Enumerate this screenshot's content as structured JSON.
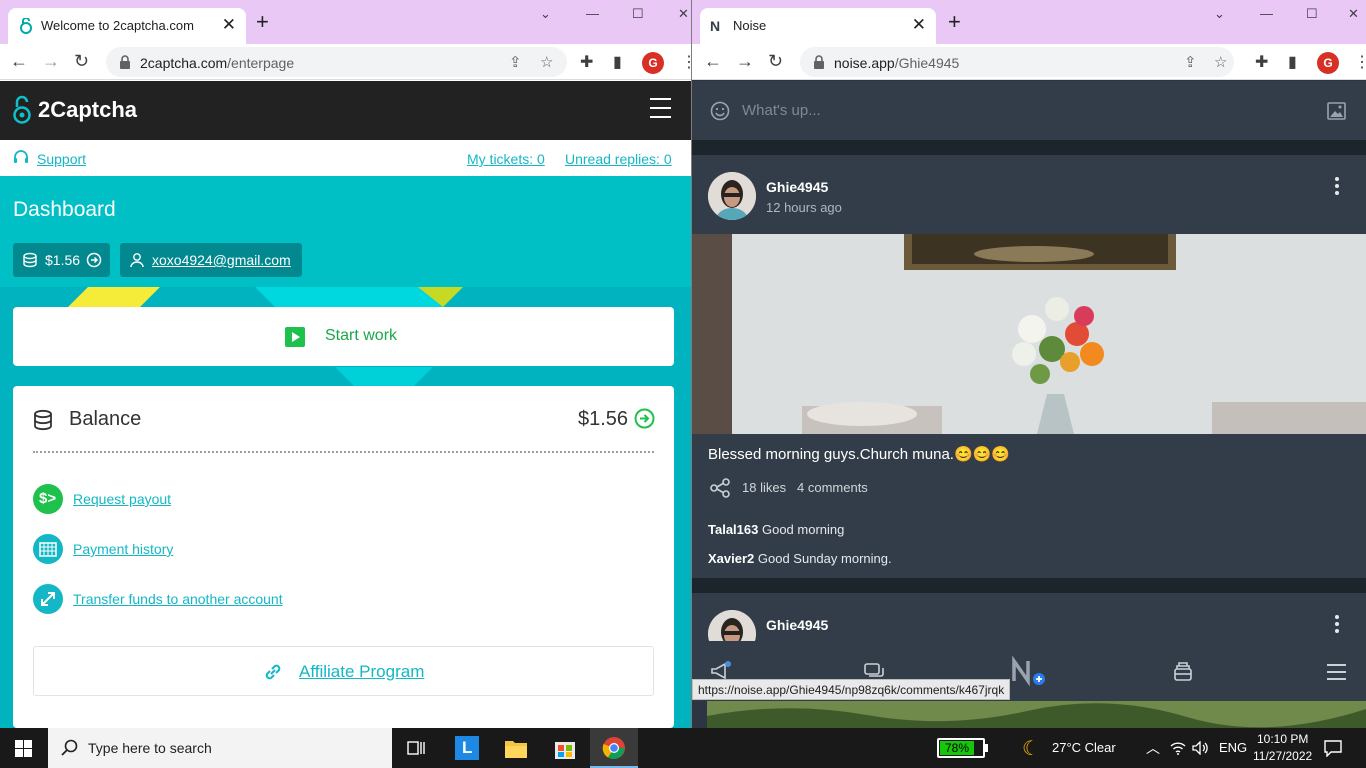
{
  "left_window": {
    "tab_title": "Welcome to 2captcha.com",
    "url_host": "2captcha.com",
    "url_path": "/enterpage",
    "profile_letter": "G",
    "brand": "2Captcha",
    "support_label": "Support",
    "my_tickets": "My tickets: 0",
    "unread_replies": "Unread replies: 0",
    "dashboard_title": "Dashboard",
    "balance_pill": "$1.56",
    "email_pill": "xoxo4924@gmail.com",
    "start_work": "Start work",
    "balance_title": "Balance",
    "balance_amount": "$1.56",
    "links": [
      {
        "label": "Request payout",
        "icon": "dollar-arrow-icon"
      },
      {
        "label": "Payment history",
        "icon": "calendar-icon"
      },
      {
        "label": "Transfer funds to another account",
        "icon": "transfer-arrows-icon"
      }
    ],
    "affiliate": "Affiliate Program"
  },
  "right_window": {
    "tab_title": "Noise",
    "url_host": "noise.app",
    "url_path": "/Ghie4945",
    "profile_letter": "G",
    "compose_placeholder": "What's up...",
    "post": {
      "author": "Ghie4945",
      "time": "12 hours ago",
      "text": "Blessed morning guys.Church muna.😊😊😊",
      "likes": "18 likes",
      "comments": "4 comments",
      "comment_list": [
        {
          "user": "Talal163",
          "text": "Good morning"
        },
        {
          "user": "Xavier2",
          "text": "Good Sunday morning."
        }
      ]
    },
    "post2_author": "Ghie4945",
    "status_url": "https://noise.app/Ghie4945/np98zq6k/comments/k467jrqk"
  },
  "taskbar": {
    "search_placeholder": "Type here to search",
    "battery": "78%",
    "battery_level": 0.78,
    "weather": "27°C  Clear",
    "language": "ENG",
    "time": "10:10 PM",
    "date": "11/27/2022"
  },
  "colors": {
    "teal": "#00c0c6",
    "teal_dark": "#02898f",
    "green": "#1ec14b",
    "noise_bg": "#333d49"
  }
}
